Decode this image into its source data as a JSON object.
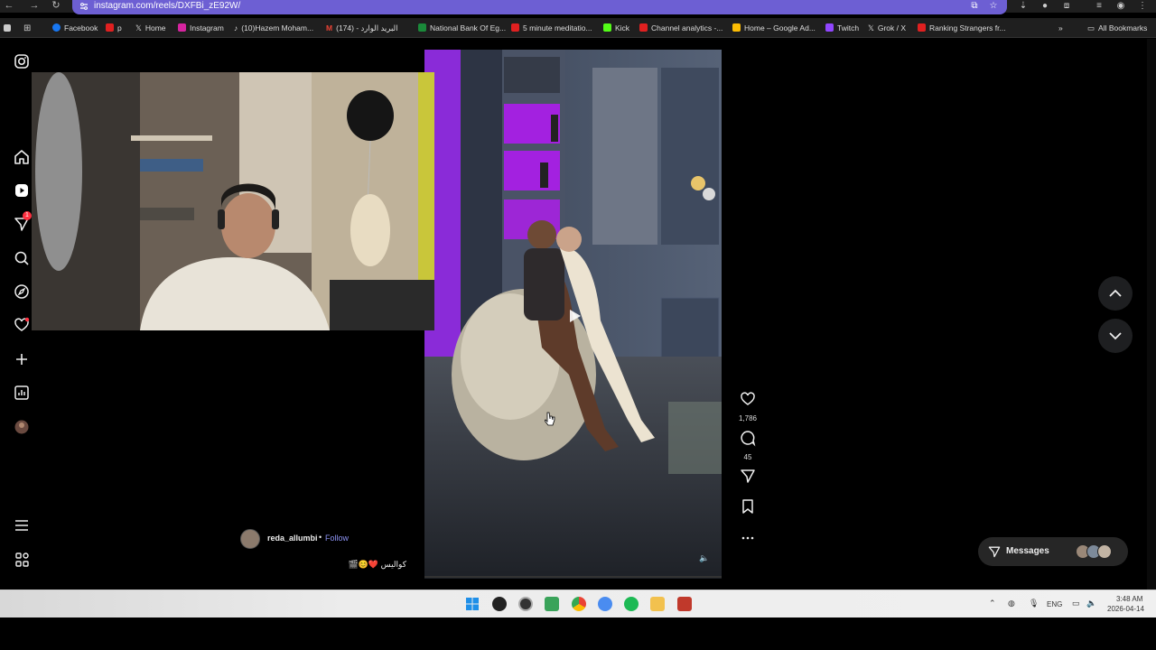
{
  "browser": {
    "url": "instagram.com/reels/DXFBi_zE92W/",
    "bookmarks": [
      {
        "label": "Facebook",
        "color": "#1877f2"
      },
      {
        "label": "p",
        "color": "#e02020"
      },
      {
        "label": "Home",
        "color": "#ffffff"
      },
      {
        "label": "Instagram",
        "color": "#d6249f"
      },
      {
        "label": "(10)Hazem Moham...",
        "color": "#ffffff"
      },
      {
        "label": "البريد الوارد - (174)",
        "color": "#ea4335"
      },
      {
        "label": "National Bank Of Eg...",
        "color": "#1a8a3a"
      },
      {
        "label": "5 minute meditatio...",
        "color": "#e02020"
      },
      {
        "label": "Kick",
        "color": "#53fc18"
      },
      {
        "label": "Channel analytics -...",
        "color": "#e02020"
      },
      {
        "label": "Home – Google Ad...",
        "color": "#fbbc04"
      },
      {
        "label": "Twitch",
        "color": "#9146ff"
      },
      {
        "label": "Grok / X",
        "color": "#ffffff"
      },
      {
        "label": "Ranking Strangers fr...",
        "color": "#e02020"
      }
    ],
    "all_bookmarks_label": "All Bookmarks"
  },
  "reel": {
    "username": "reda_allumbi",
    "separator": "•",
    "follow_label": "Follow",
    "caption": "كواليس ❤️😊🎬",
    "likes": "1,786",
    "comments": "45"
  },
  "messages": {
    "label": "Messages"
  },
  "notifications": {
    "badge": "1"
  },
  "taskbar": {
    "language": "ENG",
    "time": "3:48 AM",
    "date": "2026-04-14"
  }
}
